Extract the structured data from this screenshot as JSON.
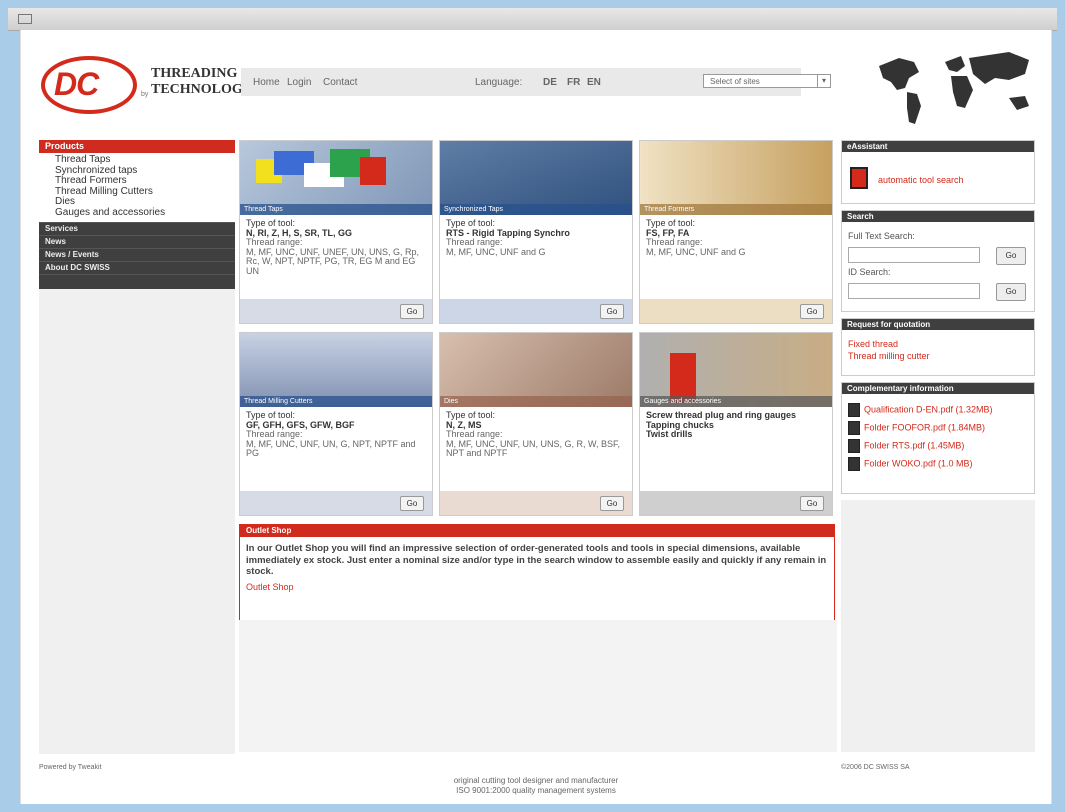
{
  "header": {
    "logo_text": "DC",
    "brand_line1": "THREADING",
    "brand_line2": "TECHNOLOGY",
    "brand_by": "by",
    "nav": [
      "Home",
      "Login",
      "Contact"
    ],
    "language_label": "Language:",
    "languages": [
      "DE",
      "FR",
      "EN"
    ],
    "dropdown_value": "Select of sites"
  },
  "sidebar": {
    "products": "Products",
    "product_items": [
      "Thread Taps",
      "Synchronized taps",
      "Thread Formers",
      "Thread Milling Cutters",
      "Dies",
      "Gauges and accessories"
    ],
    "sections": [
      "Services",
      "News",
      "News / Events",
      "About DC SWISS"
    ]
  },
  "cards": [
    {
      "caption": "Thread Taps",
      "type_label": "Type of tool:",
      "type": "N, RI, Z, H, S, SR, TL, GG",
      "range_label": "Thread range:",
      "range": "M, MF, UNC, UNF, UNEF, UN, UNS, G, Rp, Rc, W, NPT, NPTF, PG, TR, EG M and EG UN",
      "go": "Go"
    },
    {
      "caption": "Synchronized Taps",
      "type_label": "Type of tool:",
      "type": "RTS - Rigid Tapping Synchro",
      "range_label": "Thread range:",
      "range": "M, MF, UNC, UNF and G",
      "go": "Go"
    },
    {
      "caption": "Thread Formers",
      "type_label": "Type of tool:",
      "type": "FS, FP, FA",
      "range_label": "Thread range:",
      "range": "M, MF, UNC, UNF and G",
      "go": "Go"
    },
    {
      "caption": "Thread Milling Cutters",
      "type_label": "Type of tool:",
      "type": "GF, GFH, GFS, GFW, BGF",
      "range_label": "Thread range:",
      "range": "M, MF, UNC, UNF, UN, G, NPT, NPTF and PG",
      "go": "Go"
    },
    {
      "caption": "Dies",
      "type_label": "Type of tool:",
      "type": "N, Z, MS",
      "range_label": "Thread range:",
      "range": "M, MF, UNC, UNF, UN, UNS, G, R, W, BSF, NPT and NPTF",
      "go": "Go"
    },
    {
      "caption": "Gauges and accessories",
      "type_label": "",
      "type": "Screw thread plug and ring gauges",
      "range_label": "Tapping chucks",
      "range": "Twist drills",
      "go": "Go"
    }
  ],
  "outlet": {
    "title": "Outlet Shop",
    "text": "In our Outlet Shop you will find an impressive selection of order-generated tools and tools in special dimensions, available immediately ex stock. Just enter a nominal size and/or type in the search window to assemble easily and quickly if any remain in stock.",
    "link": "Outlet Shop"
  },
  "right": {
    "eassistant_title": "eAssistant",
    "eassistant_link": "automatic tool search",
    "search_title": "Search",
    "fulltext_label": "Full Text Search:",
    "id_label": "ID Search:",
    "go": "Go",
    "quotation_title": "Request for quotation",
    "quotation_links": [
      "Fixed thread",
      "Thread milling cutter"
    ],
    "info_title": "Complementary information",
    "info_links": [
      "Qualification D-EN.pdf (1.32MB)",
      "Folder FOOFOR.pdf (1.84MB)",
      "Folder RTS.pdf (1.45MB)",
      "Folder WOKO.pdf (1.0 MB)"
    ]
  },
  "footer": {
    "left": "Powered by Tweakit",
    "right": "©2006 DC SWISS SA",
    "center1": "original cutting tool designer and manufacturer",
    "center2": "ISO 9001:2000 quality management systems"
  },
  "colors": {
    "accent": "#cf2c1f",
    "dark": "#3f3f3f"
  }
}
